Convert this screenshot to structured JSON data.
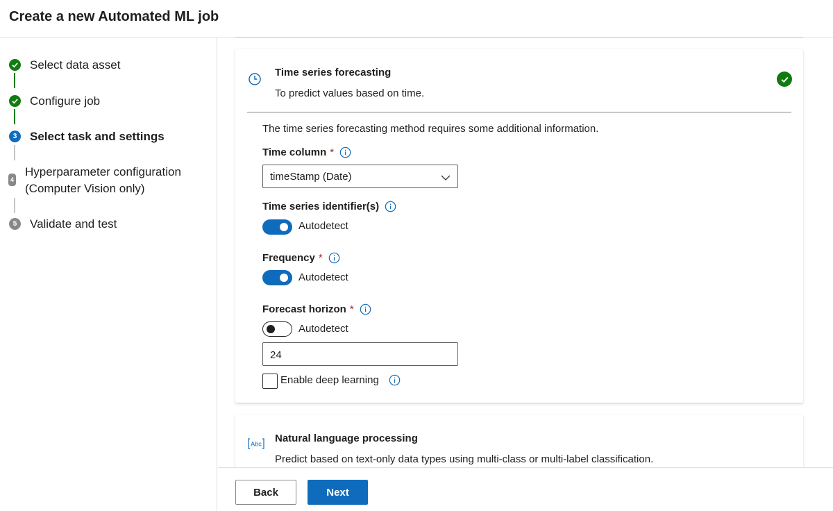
{
  "header": {
    "title": "Create a new Automated ML job"
  },
  "steps": [
    {
      "label": "Select data asset",
      "status": "done"
    },
    {
      "label": "Configure job",
      "status": "done"
    },
    {
      "label": "Select task and settings",
      "status": "current",
      "number": "3"
    },
    {
      "label_line1": "Hyperparameter configuration",
      "label_line2": "(Computer Vision only)",
      "status": "todo",
      "number": "4"
    },
    {
      "label": "Validate and test",
      "status": "todo",
      "number": "5"
    }
  ],
  "ts_card": {
    "title": "Time series forecasting",
    "description": "To predict values based on time.",
    "icon": "clock-icon",
    "selected": true,
    "intro": "The time series forecasting method requires some additional information.",
    "time_column": {
      "label": "Time column",
      "required": "*",
      "value": "timeStamp (Date)"
    },
    "identifiers": {
      "label": "Time series identifier(s)",
      "toggle_label": "Autodetect",
      "toggle_on": true
    },
    "frequency": {
      "label": "Frequency",
      "required": "*",
      "toggle_label": "Autodetect",
      "toggle_on": true
    },
    "horizon": {
      "label": "Forecast horizon",
      "required": "*",
      "toggle_label": "Autodetect",
      "toggle_on": false,
      "value": "24"
    },
    "deep_learning": {
      "label": "Enable deep learning",
      "checked": false
    }
  },
  "nlp_card": {
    "title": "Natural language processing",
    "description": "Predict based on text-only data types using multi-class or multi-label classification.",
    "icon": "text-abc-icon"
  },
  "footer": {
    "back_label": "Back",
    "next_label": "Next"
  },
  "colors": {
    "accent": "#0f6cbd",
    "success": "#107c10",
    "required": "#a4262c"
  }
}
